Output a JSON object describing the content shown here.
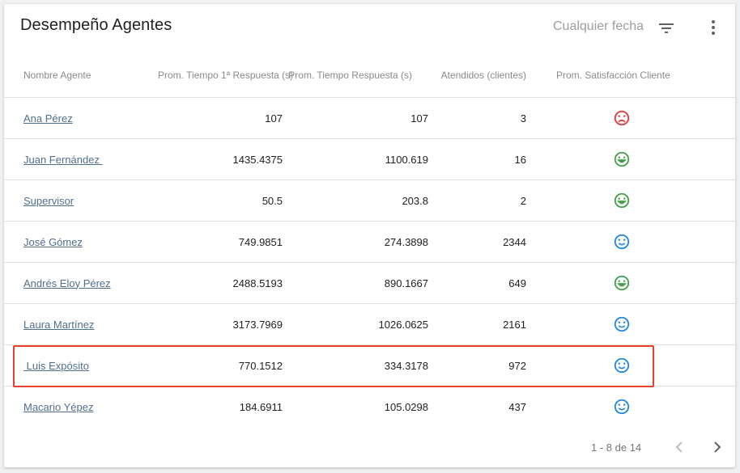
{
  "header": {
    "title": "Desempeño Agentes",
    "date_filter": "Cualquier fecha",
    "filter_icon": "filter-list-icon",
    "more_icon": "more-vert-icon"
  },
  "table": {
    "columns": [
      "Nombre Agente",
      "Prom. Tiempo 1ª Respuesta (s)",
      "Prom. Tiempo Respuesta (s)",
      "Atendidos (clientes)",
      "Prom. Satisfacción Cliente"
    ],
    "rows": [
      {
        "name": "Ana Pérez",
        "first_response": "107",
        "response": "107",
        "attended": "3",
        "satisfaction": "sad"
      },
      {
        "name": "Juan Fernández ",
        "first_response": "1435.4375",
        "response": "1100.619",
        "attended": "16",
        "satisfaction": "happy"
      },
      {
        "name": "Supervisor",
        "first_response": "50.5",
        "response": "203.8",
        "attended": "2",
        "satisfaction": "happy"
      },
      {
        "name": "José Gómez",
        "first_response": "749.9851",
        "response": "274.3898",
        "attended": "2344",
        "satisfaction": "neutral"
      },
      {
        "name": "Andrés Eloy Pérez",
        "first_response": "2488.5193",
        "response": "890.1667",
        "attended": "649",
        "satisfaction": "happy"
      },
      {
        "name": "Laura Martínez",
        "first_response": "3173.7969",
        "response": "1026.0625",
        "attended": "2161",
        "satisfaction": "neutral"
      },
      {
        "name": " Luis Expósito",
        "first_response": "770.1512",
        "response": "334.3178",
        "attended": "972",
        "satisfaction": "neutral"
      },
      {
        "name": "Macario Yépez",
        "first_response": "184.6911",
        "response": "105.0298",
        "attended": "437",
        "satisfaction": "neutral"
      }
    ],
    "highlighted_row_index": 6
  },
  "satisfaction_colors": {
    "sad": "#e53935",
    "happy": "#43a047",
    "neutral": "#1e88e5"
  },
  "footer": {
    "page_info": "1 - 8 de 14",
    "prev_icon": "chevron-left-icon",
    "next_icon": "chevron-right-icon"
  },
  "colors": {
    "highlight_border": "#e8402a",
    "link": "#4f6f8f"
  }
}
